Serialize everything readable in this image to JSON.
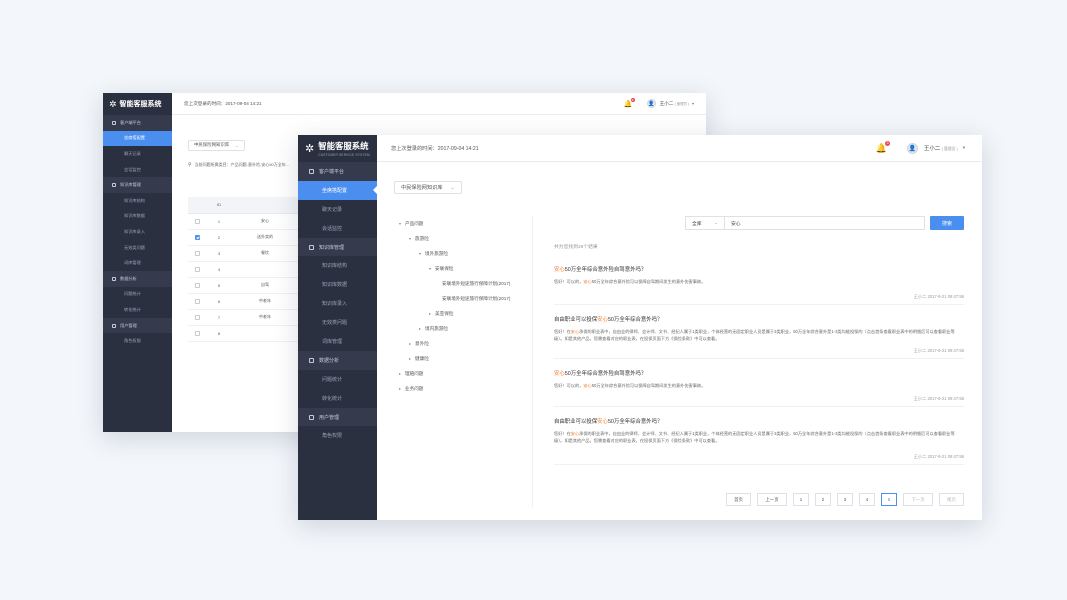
{
  "app": {
    "title": "智能客服系统",
    "subtitle": "CUSTOMER SERVICE SYSTEM",
    "last_login": "您上次登录的时间：2017-09-04 14:21",
    "notification_count": "3",
    "user_name": "王小二",
    "user_role": "( 管理员 )"
  },
  "sidebar": {
    "items": [
      {
        "label": "客户端平台",
        "type": "group"
      },
      {
        "label": "坐席搭配置",
        "type": "active"
      },
      {
        "label": "聊天记录",
        "type": "item"
      },
      {
        "label": "会话监控",
        "type": "item"
      },
      {
        "label": "知识库管理",
        "type": "group"
      },
      {
        "label": "知识库结构",
        "type": "item"
      },
      {
        "label": "知识库数据",
        "type": "item"
      },
      {
        "label": "知识库录入",
        "type": "item"
      },
      {
        "label": "无效类问题",
        "type": "item"
      },
      {
        "label": "词库管理",
        "type": "item"
      },
      {
        "label": "数据分析",
        "type": "group"
      },
      {
        "label": "问题统计",
        "type": "item"
      },
      {
        "label": "转化统计",
        "type": "item"
      },
      {
        "label": "用户管理",
        "type": "group"
      },
      {
        "label": "角色权限",
        "type": "item"
      }
    ]
  },
  "back": {
    "kb_select": "中民保险网知识库",
    "breadcrumb": "当前问题所属类目：产品问题-意外险-安心50万全年...",
    "table": {
      "id_header": "ID",
      "rows": [
        {
          "id": "1",
          "checked": false,
          "text": "安心"
        },
        {
          "id": "2",
          "checked": true,
          "text": "送外卖的"
        },
        {
          "id": "3",
          "checked": false,
          "text": "餐饮"
        },
        {
          "id": "4",
          "checked": false,
          "text": ""
        },
        {
          "id": "5",
          "checked": false,
          "text": "自驾"
        },
        {
          "id": "6",
          "checked": false,
          "text": "中老年"
        },
        {
          "id": "7",
          "checked": false,
          "text": "中老年"
        },
        {
          "id": "8",
          "checked": false,
          "text": ""
        }
      ]
    }
  },
  "front": {
    "kb_select": "中民保险网知识库",
    "tree": [
      {
        "label": "产品问题",
        "level": 0,
        "arrow": "▾"
      },
      {
        "label": "旅游险",
        "level": 1,
        "arrow": "▾"
      },
      {
        "label": "境外旅游险",
        "level": 2,
        "arrow": "▾"
      },
      {
        "label": "安联保险",
        "level": 3,
        "arrow": "▾"
      },
      {
        "label": "安联境外短途旅行保障计划(2017)",
        "level": 4,
        "arrow": ""
      },
      {
        "label": "安联境外短途旅行保障计划(2017)",
        "level": 4,
        "arrow": "",
        "selected": true
      },
      {
        "label": "美亚保险",
        "level": 3,
        "arrow": "▸"
      },
      {
        "label": "境内旅游险",
        "level": 2,
        "arrow": "▸"
      },
      {
        "label": "意外险",
        "level": 1,
        "arrow": "▸"
      },
      {
        "label": "健康险",
        "level": 1,
        "arrow": "▸"
      },
      {
        "label": "理赔问题",
        "level": 0,
        "arrow": "▸"
      },
      {
        "label": "业务问题",
        "level": 0,
        "arrow": "▸"
      }
    ],
    "search": {
      "scope": "全库",
      "query": "安心",
      "button": "搜索"
    },
    "total": "共为您找到28个结果",
    "results": [
      {
        "q_pre": "",
        "q_hl": "安心",
        "q_post": "50万全年综合意外险自驾意外吗？",
        "a_pre": "您好！可以的，",
        "a_hl": "安心",
        "a_post": "50万全年综合意外险可以保障自驾期间发生的意外伤害事故。",
        "author": "王小二",
        "time": "2017-9-21 09:47:58"
      },
      {
        "q_pre": "自由职业可以投保",
        "q_hl": "安心",
        "q_post": "50万全年综合意外吗？",
        "a_pre": "您好！在",
        "a_hl": "安心",
        "a_post": "承保的职业表中，自由业的律师、会计师、文书、经纪人属于1类职业，个体经营的无固定职业人员是属于3类职业，50万全年综合意外是1-3类均能投保的（点击首条查看职业表中的明细后可以查看职业等级）。如是其他产品，您需查看对应的职业表，在投保页面下方《保险条款》中可以查看。",
        "author": "王小二",
        "time": "2017-9-21 09:47:58"
      },
      {
        "q_pre": "",
        "q_hl": "安心",
        "q_post": "50万全年综合意外险自驾意外吗？",
        "a_pre": "您好！可以的，",
        "a_hl": "安心",
        "a_post": "50万全年综合意外险可以保障自驾期间发生的意外伤害事故。",
        "author": "王小二",
        "time": "2017-9-21 09:47:58"
      },
      {
        "q_pre": "自由职业可以投保",
        "q_hl": "安心",
        "q_post": "50万全年综合意外吗？",
        "a_pre": "您好！在",
        "a_hl": "安心",
        "a_post": "承保的职业表中，自由业的律师、会计师、文书、经纪人属于1类职业，个体经营的无固定职业人员是属于3类职业，50万全年综合意外是1-3类均能投保的（点击首条查看职业表中的明细后可以查看职业等级）。如是其他产品，您需查看对应的职业表，在投保页面下方《保险条款》中可以查看。",
        "author": "王小二",
        "time": "2017-9-21 09:47:58"
      }
    ],
    "pager": {
      "first": "首页",
      "prev": "上一页",
      "pages": [
        "1",
        "2",
        "3",
        "4",
        "5"
      ],
      "current": "5",
      "next": "下一页",
      "last": "尾页"
    }
  },
  "colors": {
    "sidebar_bg": "#2b3040",
    "accent": "#4a8ff0",
    "highlight": "#f07a2a",
    "badge": "#f04848"
  }
}
